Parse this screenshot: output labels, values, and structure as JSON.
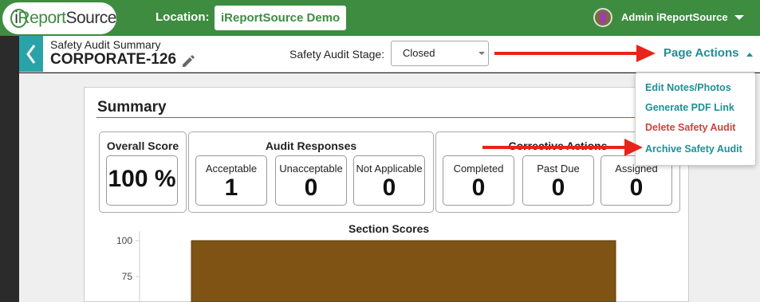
{
  "topbar": {
    "logo_text_pre": "i",
    "logo_text_mid": "Report",
    "logo_text_post": "Source",
    "location_label": "Location:",
    "location_value": "iReportSource Demo",
    "user_name": "Admin iReportSource"
  },
  "header": {
    "subtitle": "Safety Audit Summary",
    "record_id": "CORPORATE-126",
    "stage_label": "Safety Audit Stage:",
    "stage_value": "Closed",
    "page_actions_label": "Page Actions"
  },
  "page_actions_menu": [
    {
      "label": "Edit Notes/Photos",
      "style": "normal"
    },
    {
      "label": "Generate PDF Link",
      "style": "normal"
    },
    {
      "label": "Delete Safety Audit",
      "style": "danger"
    },
    {
      "label": "Archive Safety Audit",
      "style": "normal"
    }
  ],
  "summary": {
    "title": "Summary",
    "overall": {
      "title": "Overall Score",
      "value": "100 %"
    },
    "audit_responses": {
      "title": "Audit Responses",
      "items": [
        {
          "label": "Acceptable",
          "value": "1"
        },
        {
          "label": "Unacceptable",
          "value": "0"
        },
        {
          "label": "Not Applicable",
          "value": "0"
        }
      ]
    },
    "corrective_actions": {
      "title": "Corrective Actions",
      "items": [
        {
          "label": "Completed",
          "value": "0"
        },
        {
          "label": "Past Due",
          "value": "0"
        },
        {
          "label": "Assigned",
          "value": "0"
        }
      ]
    }
  },
  "chart_data": {
    "type": "bar",
    "title": "Section Scores",
    "categories": [
      ""
    ],
    "values": [
      100
    ],
    "ylim": [
      0,
      100
    ],
    "yticks": [
      "100",
      "75"
    ],
    "bar_color": "#7e5313"
  },
  "colors": {
    "brand_green": "#3d8c40",
    "teal": "#1e8f95",
    "danger": "#c9433f",
    "annotation_red": "#e8231c"
  }
}
